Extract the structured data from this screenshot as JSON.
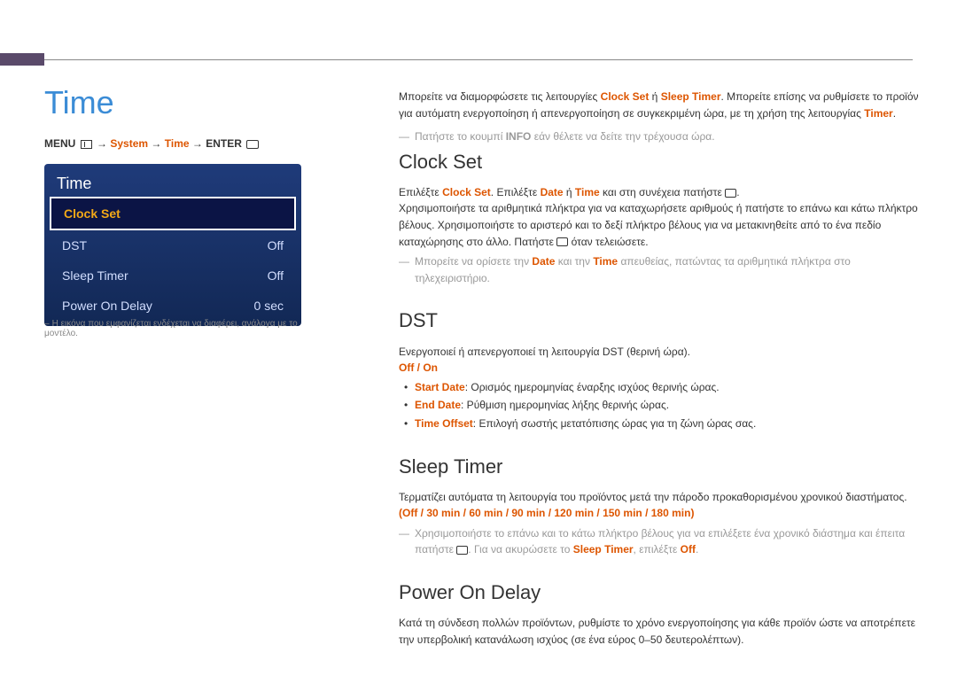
{
  "pageTitle": "Time",
  "breadcrumb": {
    "menuLabel": "MENU",
    "system": "System",
    "time": "Time",
    "enter": "ENTER",
    "arrow": "→"
  },
  "menu": {
    "title": "Time",
    "items": [
      {
        "label": "Clock Set",
        "value": "",
        "selected": true
      },
      {
        "label": "DST",
        "value": "Off",
        "selected": false
      },
      {
        "label": "Sleep Timer",
        "value": "Off",
        "selected": false
      },
      {
        "label": "Power On Delay",
        "value": "0 sec",
        "selected": false
      }
    ],
    "footnote": "Η εικόνα που εμφανίζεται ενδέχεται να διαφέρει, ανάλογα με το μοντέλο."
  },
  "intro": {
    "p1a": "Μπορείτε να διαμορφώσετε τις λειτουργίες ",
    "clockSet": "Clock Set",
    "p1b": " ή ",
    "sleepTimer": "Sleep Timer",
    "p1c": ". Μπορείτε επίσης να ρυθμίσετε το προϊόν για αυτόματη ενεργοποίηση ή απενεργοποίηση σε συγκεκριμένη ώρα, με τη χρήση της λειτουργίας ",
    "timer": "Timer",
    "p1d": ".",
    "infoNote1": "Πατήστε το κουμπί ",
    "infoBold": "INFO",
    "infoNote2": " εάν θέλετε να δείτε την τρέχουσα ώρα."
  },
  "sections": {
    "clockSet": {
      "heading": "Clock Set",
      "p1a": "Επιλέξτε ",
      "cs": "Clock Set",
      "p1b": ". Επιλέξτε ",
      "date": "Date",
      "p1c": " ή ",
      "time": "Time",
      "p1d": " και στη συνέχεια πατήστε ",
      "p1e": ".",
      "p2": "Χρησιμοποιήστε τα αριθμητικά πλήκτρα για να καταχωρήσετε αριθμούς ή πατήστε το επάνω και κάτω πλήκτρο βέλους. Χρησιμοποιήστε το αριστερό και το δεξί πλήκτρο βέλους για να μετακινηθείτε από το ένα πεδίο καταχώρησης στο άλλο. Πατήστε ",
      "p2b": " όταν τελειώσετε.",
      "noteA": "Μπορείτε να ορίσετε την ",
      "noteB": " και την ",
      "noteC": " απευθείας, πατώντας τα αριθμητικά πλήκτρα στο τηλεχειριστήριο."
    },
    "dst": {
      "heading": "DST",
      "body": "Ενεργοποιεί ή απενεργοποιεί τη λειτουργία DST (θερινή ώρα).",
      "options": "Off / On",
      "items": [
        {
          "label": "Start Date",
          "text": ": Ορισμός ημερομηνίας έναρξης ισχύος θερινής ώρας."
        },
        {
          "label": "End Date",
          "text": ": Ρύθμιση ημερομηνίας λήξης θερινής ώρας."
        },
        {
          "label": "Time Offset",
          "text": ": Επιλογή σωστής μετατόπισης ώρας για τη ζώνη ώρας σας."
        }
      ]
    },
    "sleepTimer": {
      "heading": "Sleep Timer",
      "body": "Τερματίζει αυτόματα τη λειτουργία του προϊόντος μετά την πάροδο προκαθορισμένου χρονικού διαστήματος.",
      "options": "(Off / 30 min / 60 min / 90 min / 120 min / 150 min / 180 min)",
      "noteA": "Χρησιμοποιήστε το επάνω και το κάτω πλήκτρο βέλους για να επιλέξετε ένα χρονικό διάστημα και έπειτα πατήστε ",
      "noteB": ". Για να ακυρώσετε το ",
      "sleep": "Sleep Timer",
      "noteC": ", επιλέξτε ",
      "off": "Off",
      "noteD": "."
    },
    "powerOnDelay": {
      "heading": "Power On Delay",
      "body": "Κατά τη σύνδεση πολλών προϊόντων, ρυθμίστε το χρόνο ενεργοποίησης για κάθε προϊόν ώστε να αποτρέπετε την υπερβολική κατανάλωση ισχύος (σε ένα εύρος 0–50 δευτερολέπτων)."
    }
  }
}
